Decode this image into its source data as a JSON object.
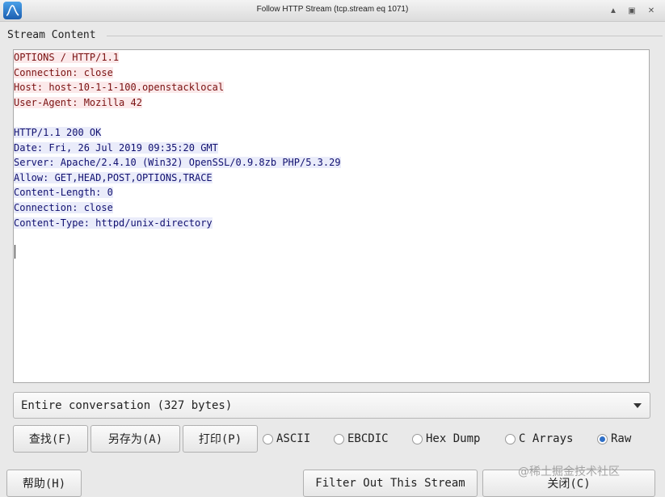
{
  "window": {
    "title": "Follow HTTP Stream (tcp.stream eq 1071)",
    "app_icon": "wireshark-fin-icon"
  },
  "section_label": "Stream Content",
  "stream_lines": [
    {
      "kind": "client",
      "text": "OPTIONS / HTTP/1.1"
    },
    {
      "kind": "client",
      "text": "Connection: close"
    },
    {
      "kind": "client",
      "text": "Host: host-10-1-1-100.openstacklocal"
    },
    {
      "kind": "client",
      "text": "User-Agent: Mozilla 42"
    },
    {
      "kind": "blank",
      "text": ""
    },
    {
      "kind": "server",
      "text": "HTTP/1.1 200 OK"
    },
    {
      "kind": "server",
      "text": "Date: Fri, 26 Jul 2019 09:35:20 GMT"
    },
    {
      "kind": "server",
      "text": "Server: Apache/2.4.10 (Win32) OpenSSL/0.9.8zb PHP/5.3.29"
    },
    {
      "kind": "server",
      "text": "Allow: GET,HEAD,POST,OPTIONS,TRACE"
    },
    {
      "kind": "server",
      "text": "Content-Length: 0"
    },
    {
      "kind": "server",
      "text": "Connection: close"
    },
    {
      "kind": "server",
      "text": "Content-Type: httpd/unix-directory"
    }
  ],
  "colors": {
    "client_text": "#7a1010",
    "client_bg": "#fbe9ea",
    "server_text": "#101070",
    "server_bg": "#eaecfa"
  },
  "conversation_select": {
    "value": "Entire conversation (327 bytes)"
  },
  "buttons": {
    "find": "查找(F)",
    "save_as": "另存为(A)",
    "print": "打印(P)",
    "help": "帮助(H)",
    "filter_out": "Filter Out This Stream",
    "close": "关闭(C)"
  },
  "formats": {
    "ascii": "ASCII",
    "ebcdic": "EBCDIC",
    "hex_dump": "Hex Dump",
    "c_arrays": "C Arrays",
    "raw": "Raw",
    "selected": "raw"
  },
  "watermark": "@稀土掘金技术社区"
}
